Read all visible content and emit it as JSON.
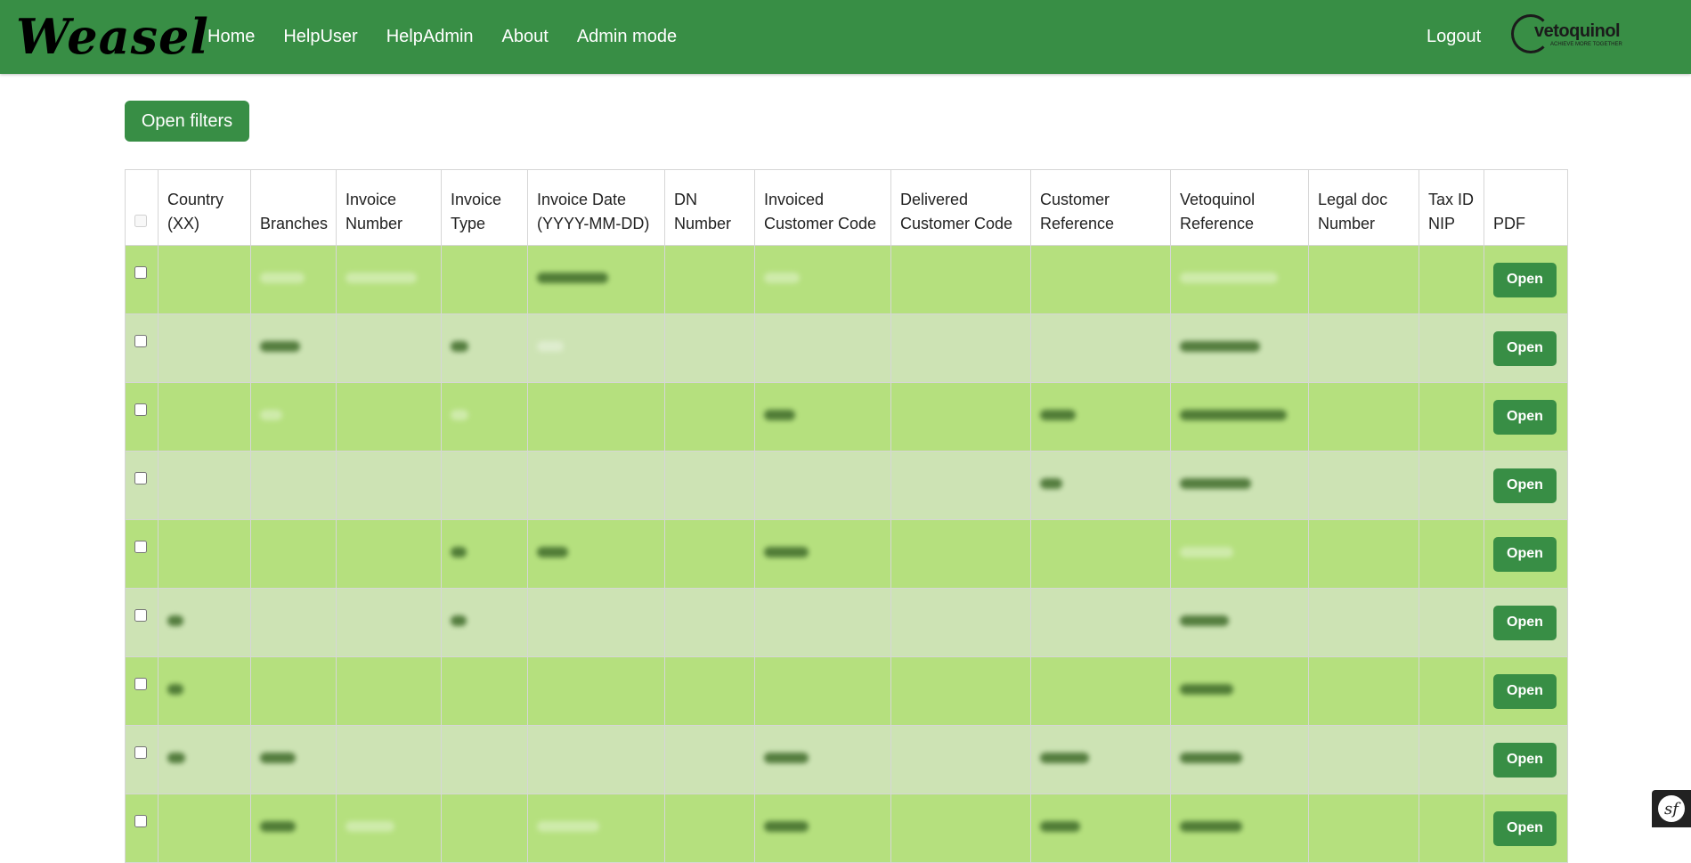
{
  "nav": {
    "brand": "Weasel",
    "links": [
      "Home",
      "HelpUser",
      "HelpAdmin",
      "About",
      "Admin mode"
    ],
    "logout": "Logout",
    "logo_text": "vetoquinol",
    "logo_tagline": "ACHIEVE MORE TOGETHER"
  },
  "filters_button": "Open filters",
  "table": {
    "headers": [
      {
        "line1": "Country",
        "line2": "(XX)"
      },
      {
        "line1": "",
        "line2": "Branches"
      },
      {
        "line1": "Invoice",
        "line2": "Number"
      },
      {
        "line1": "Invoice",
        "line2": "Type"
      },
      {
        "line1": "Invoice Date",
        "line2": "(YYYY-MM-DD)"
      },
      {
        "line1": "DN",
        "line2": "Number"
      },
      {
        "line1": "Invoiced",
        "line2": "Customer Code"
      },
      {
        "line1": "Delivered",
        "line2": "Customer Code"
      },
      {
        "line1": "Customer",
        "line2": "Reference"
      },
      {
        "line1": "Vetoquinol",
        "line2": "Reference"
      },
      {
        "line1": "Legal doc",
        "line2": "Number"
      },
      {
        "line1": "Tax ID",
        "line2": "NIP"
      },
      {
        "line1": "",
        "line2": "PDF"
      }
    ],
    "open_label": "Open",
    "row_count": 9
  },
  "colors": {
    "primary": "#388e45",
    "row_odd": "#b5e07e",
    "row_even": "#cde3b4"
  },
  "icons": {
    "symfony_toolbar": "sf"
  }
}
